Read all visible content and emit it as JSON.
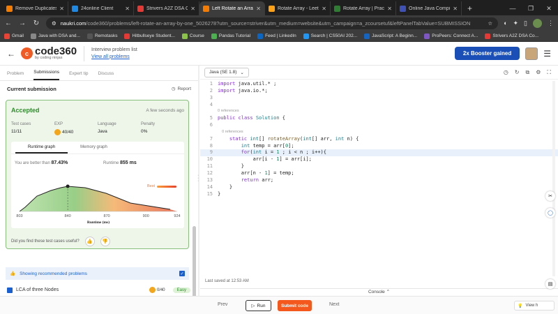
{
  "browser": {
    "tabs": [
      {
        "title": "Remove Duplicates f",
        "color": "#f57c00"
      },
      {
        "title": "24online Client",
        "color": "#1e88e5"
      },
      {
        "title": "Strivers A2Z DSA Co",
        "color": "#e53935"
      },
      {
        "title": "Left Rotate an Array",
        "color": "#f57c00"
      },
      {
        "title": "Rotate Array - LeetC",
        "color": "#ffa116"
      },
      {
        "title": "Rotate Array | Practic",
        "color": "#2e7d32"
      },
      {
        "title": "Online Java Compiler",
        "color": "#3f51b5"
      }
    ],
    "url_host": "naukri.com",
    "url_path": "/code360/problems/left-rotate-an-array-by-one_5026278?utm_source=striver&utm_medium=website&utm_campaign=a_zcoursetuf&leftPanelTabValue=SUBMISSION",
    "bookmarks": [
      "Gmail",
      "Java with DSA and...",
      "Remotasks",
      "Hitbullseye Student...",
      "Course",
      "Pandas Tutorial",
      "Feed | LinkedIn",
      "Search | CS50AI 202...",
      "JavaScript: A Beginn...",
      "ProPeers: Connect A...",
      "Strivers A2Z DSA Co..."
    ]
  },
  "header": {
    "logo_main": "code360",
    "logo_sub": "by coding ninjas",
    "label": "Interview problem list",
    "link": "View all problems",
    "booster": "2x Booster gained"
  },
  "left": {
    "tabs": [
      "Problem",
      "Submissions",
      "Expert tip",
      "Discuss"
    ],
    "title": "Current submission",
    "report": "Report",
    "status": "Accepted",
    "time_ago": "A few seconds ago",
    "stats": [
      {
        "key": "Test cases",
        "value": "11/11"
      },
      {
        "key": "EXP",
        "value": "40/40"
      },
      {
        "key": "Language",
        "value": "Java"
      },
      {
        "key": "Penalty",
        "value": "0%"
      }
    ],
    "graph_tabs": [
      "Runtime graph",
      "Memory graph"
    ],
    "beat_label": "You are better than",
    "beat_value": "87.43%",
    "runtime_label": "Runtime",
    "runtime_value": "855 ms",
    "best_label": "Best",
    "useful_q": "Did you find these test cases useful?",
    "reco": "Showing recommended problems",
    "next_problem": "LCA of three Nodes",
    "next_xp": "0/40",
    "next_difficulty": "Easy"
  },
  "chart_data": {
    "type": "area",
    "xlabel": "Runtime (ms)",
    "x_ticks": [
      "803",
      "840",
      "870",
      "900",
      "924"
    ],
    "xlim": [
      803,
      924
    ],
    "marker_x": 840
  },
  "editor": {
    "language": "Java (SE 1.8)",
    "lines": [
      {
        "n": "1",
        "text": "import java.util.* ;"
      },
      {
        "n": "2",
        "text": "import java.io.*;"
      },
      {
        "n": "3",
        "text": ""
      },
      {
        "n": "4",
        "text": ""
      },
      {
        "n": "",
        "text": "0 references",
        "ref": true
      },
      {
        "n": "5",
        "text": "public class Solution {"
      },
      {
        "n": "6",
        "text": ""
      },
      {
        "n": "",
        "text": "    0 references",
        "ref": true
      },
      {
        "n": "7",
        "text": "    static int[] rotateArray(int[] arr, int n) {"
      },
      {
        "n": "8",
        "text": "        int temp = arr[0];"
      },
      {
        "n": "9",
        "text": "        for(int i = 1 ; i < n ; i++){",
        "hl": true
      },
      {
        "n": "10",
        "text": "            arr[i - 1] = arr[i];"
      },
      {
        "n": "11",
        "text": "        }"
      },
      {
        "n": "12",
        "text": "        arr[n - 1] = temp;"
      },
      {
        "n": "13",
        "text": "        return arr;"
      },
      {
        "n": "14",
        "text": "    }"
      },
      {
        "n": "15",
        "text": "}"
      }
    ],
    "saved": "Last saved at 12:53 AM",
    "console": "Console"
  },
  "bottom": {
    "prev": "Prev",
    "run": "Run",
    "submit": "Submit code",
    "next": "Next",
    "view": "View h"
  }
}
